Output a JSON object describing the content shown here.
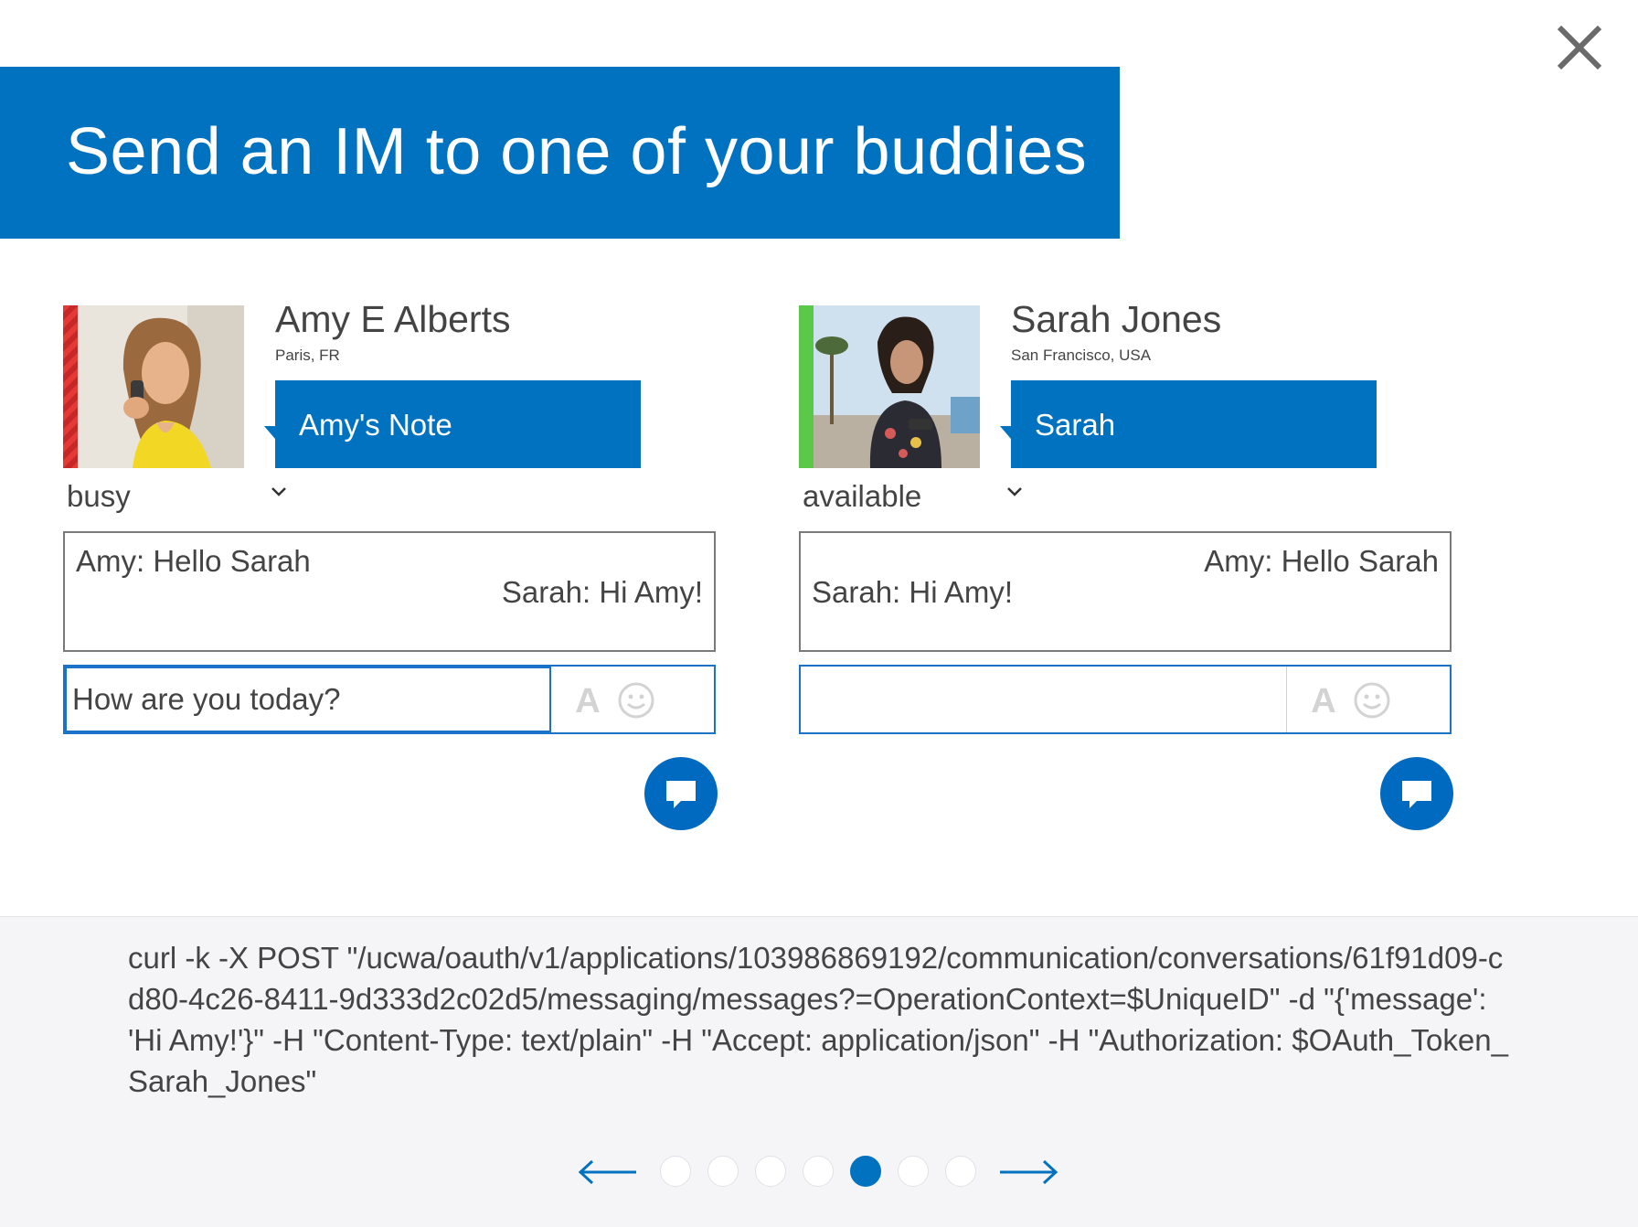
{
  "banner": {
    "title": "Send an IM to one of your buddies"
  },
  "close": {
    "icon": "close-icon"
  },
  "colors": {
    "brand": "#0072bf",
    "busy": "#e53935",
    "available": "#5cc84a"
  },
  "buddies": [
    {
      "name": "Amy E Alberts",
      "location": "Paris, FR",
      "note": "Amy's Note",
      "status": "busy",
      "messages": {
        "first": "Amy: Hello Sarah",
        "second": "Sarah: Hi Amy!"
      },
      "compose_value": "How are you today?"
    },
    {
      "name": "Sarah Jones",
      "location": "San Francisco, USA",
      "note": "Sarah",
      "status": "available",
      "messages": {
        "first": "Amy: Hello Sarah",
        "second": "Sarah: Hi Amy!"
      },
      "compose_value": ""
    }
  ],
  "code": "curl -k -X POST \"/ucwa/oauth/v1/applications/103986869192/communication/conversations/61f91d09-cd80-4c26-8411-9d333d2c02d5/messaging/messages?=OperationContext=$UniqueID\" -d \"{'message': 'Hi Amy!'}\" -H \"Content-Type: text/plain\" -H \"Accept: application/json\" -H \"Authorization: $OAuth_Token_Sarah_Jones\"",
  "pager": {
    "total": 7,
    "current": 5
  }
}
